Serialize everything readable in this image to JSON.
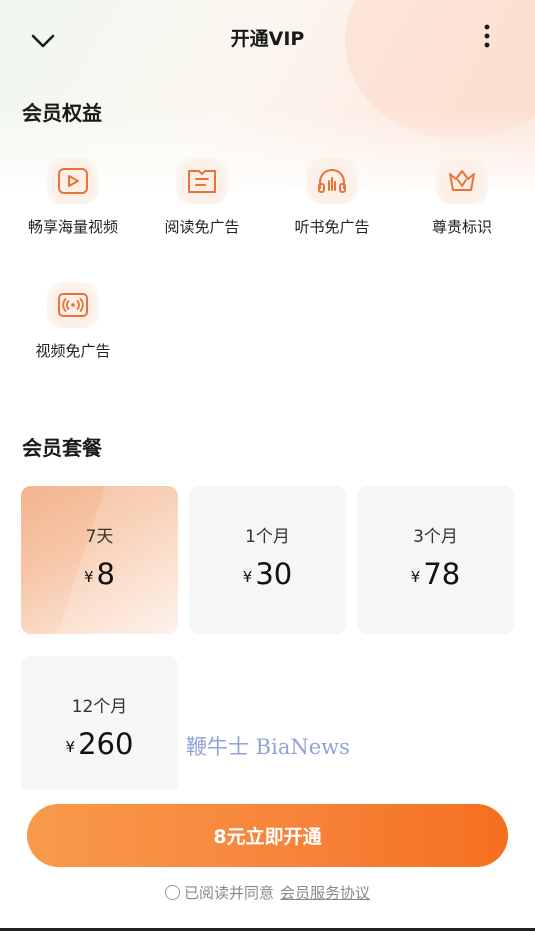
{
  "header": {
    "title": "开通VIP",
    "back_icon": "chevron-down-icon",
    "more_icon": "more-vertical-icon"
  },
  "benefits": {
    "title": "会员权益",
    "items": [
      {
        "label": "畅享海量视频",
        "icon": "video-play-icon"
      },
      {
        "label": "阅读免广告",
        "icon": "book-icon"
      },
      {
        "label": "听书免广告",
        "icon": "headphones-icon"
      },
      {
        "label": "尊贵标识",
        "icon": "crown-badge-icon"
      },
      {
        "label": "视频免广告",
        "icon": "broadcast-icon"
      }
    ]
  },
  "plans": {
    "title": "会员套餐",
    "currency": "¥",
    "items": [
      {
        "name": "7天",
        "price": "8",
        "selected": true
      },
      {
        "name": "1个月",
        "price": "30",
        "selected": false
      },
      {
        "name": "3个月",
        "price": "78",
        "selected": false
      },
      {
        "name": "12个月",
        "price": "260",
        "selected": false
      }
    ]
  },
  "watermark": "鞭牛士 BiaNews",
  "cta": {
    "label": "8元立即开通"
  },
  "agreement": {
    "prefix": "已阅读并同意",
    "link": "会员服务协议"
  },
  "colors": {
    "accent": "#f7843a",
    "icon_stroke": "#e8733a"
  }
}
